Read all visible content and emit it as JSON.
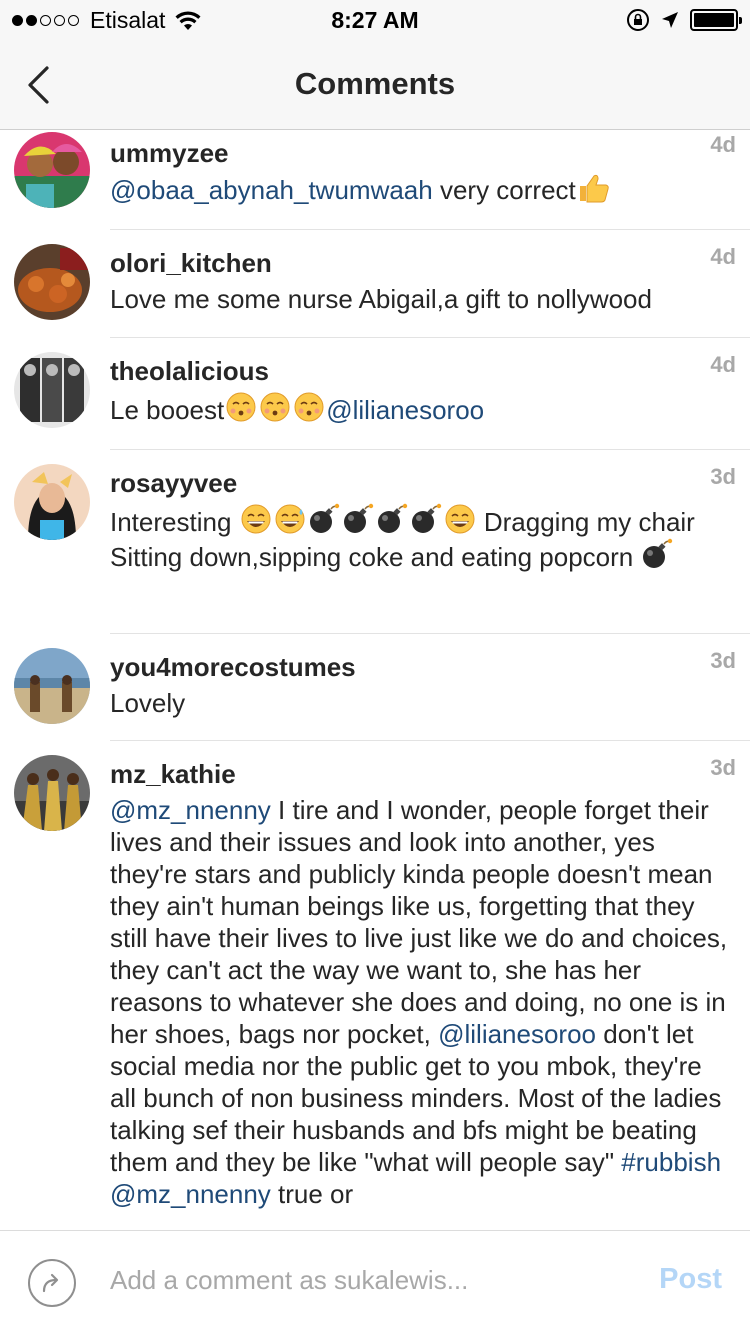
{
  "status_bar": {
    "carrier": "Etisalat",
    "time": "8:27 AM",
    "signal_filled": 2,
    "signal_total": 5
  },
  "nav": {
    "title": "Comments"
  },
  "comments": [
    {
      "username": "ummyzee",
      "time": "4d",
      "segments": [
        {
          "type": "mention",
          "text": "@obaa_abynah_twumwaah"
        },
        {
          "type": "text",
          "text": " very correct"
        },
        {
          "type": "emoji",
          "name": "thumbs-up"
        }
      ]
    },
    {
      "username": "olori_kitchen",
      "time": "4d",
      "segments": [
        {
          "type": "text",
          "text": "Love me some nurse Abigail,a gift to nollywood"
        }
      ]
    },
    {
      "username": "theolalicious",
      "time": "4d",
      "segments": [
        {
          "type": "text",
          "text": "Le booest"
        },
        {
          "type": "emoji",
          "name": "kissing-face"
        },
        {
          "type": "emoji",
          "name": "kissing-face"
        },
        {
          "type": "emoji",
          "name": "kissing-face"
        },
        {
          "type": "mention",
          "text": "@lilianesoroo"
        }
      ]
    },
    {
      "username": "rosayyvee",
      "time": "3d",
      "segments": [
        {
          "type": "text",
          "text": "Interesting "
        },
        {
          "type": "emoji",
          "name": "grinning-face"
        },
        {
          "type": "emoji",
          "name": "sweat-smile-face"
        },
        {
          "type": "emoji",
          "name": "bomb"
        },
        {
          "type": "emoji",
          "name": "bomb"
        },
        {
          "type": "emoji",
          "name": "bomb"
        },
        {
          "type": "emoji",
          "name": "bomb"
        },
        {
          "type": "emoji",
          "name": "grinning-face"
        },
        {
          "type": "text",
          "text": " Dragging my chair Sitting down,sipping coke and eating popcorn "
        },
        {
          "type": "emoji",
          "name": "bomb"
        }
      ]
    },
    {
      "username": "you4morecostumes",
      "time": "3d",
      "segments": [
        {
          "type": "text",
          "text": "Lovely"
        }
      ]
    },
    {
      "username": "mz_kathie",
      "time": "3d",
      "segments": [
        {
          "type": "mention",
          "text": "@mz_nnenny"
        },
        {
          "type": "text",
          "text": " I tire and I wonder, people forget their lives and their issues and look into another, yes they're stars and publicly kinda people doesn't mean they ain't human beings like us, forgetting that they still have their lives to live just like we do and choices, they can't act the way we want to, she has her reasons to whatever she does and doing, no one is in her shoes, bags nor pocket, "
        },
        {
          "type": "mention",
          "text": "@lilianesoroo"
        },
        {
          "type": "text",
          "text": " don't let social media nor the public get to you mbok, they're all bunch of non business minders. Most of the ladies talking sef their husbands and bfs might be beating them and they be like \"what will people say\" "
        },
        {
          "type": "mention",
          "text": "#rubbish"
        },
        {
          "type": "text",
          "text": " "
        },
        {
          "type": "mention",
          "text": "@mz_nnenny"
        },
        {
          "type": "text",
          "text": " true or"
        }
      ]
    }
  ],
  "bottom_bar": {
    "placeholder": "Add a comment as sukalewis...",
    "post_label": "Post"
  },
  "colors": {
    "mention": "#1f4a78",
    "timestamp": "#a8a8a8",
    "post_disabled": "#b4d6f7"
  }
}
